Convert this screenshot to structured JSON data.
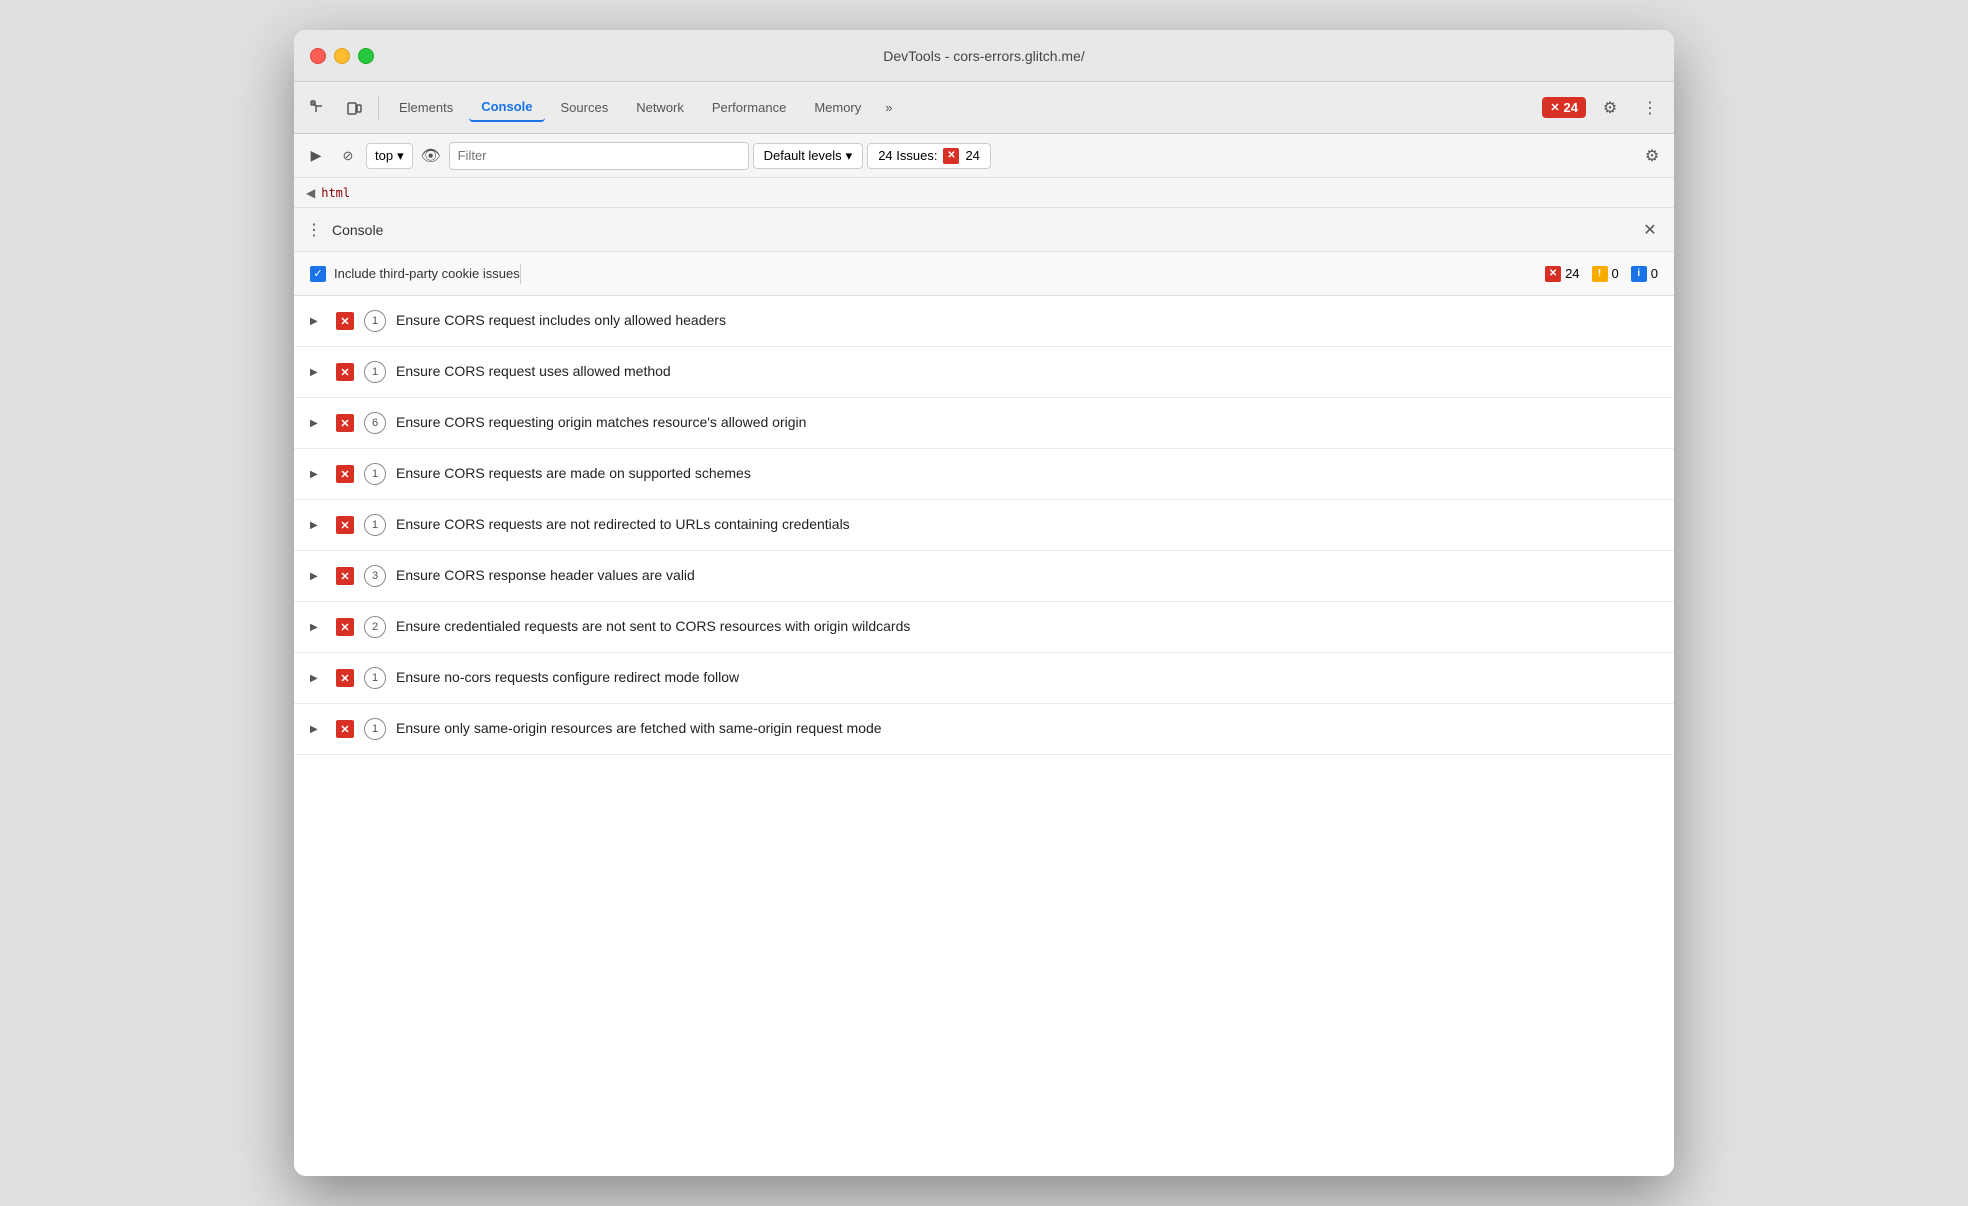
{
  "window": {
    "title": "DevTools - cors-errors.glitch.me/"
  },
  "traffic_lights": {
    "red": "red",
    "yellow": "yellow",
    "green": "green"
  },
  "tabs": [
    {
      "id": "elements",
      "label": "Elements",
      "active": false
    },
    {
      "id": "console",
      "label": "Console",
      "active": true
    },
    {
      "id": "sources",
      "label": "Sources",
      "active": false
    },
    {
      "id": "network",
      "label": "Network",
      "active": false
    },
    {
      "id": "performance",
      "label": "Performance",
      "active": false
    },
    {
      "id": "memory",
      "label": "Memory",
      "active": false
    }
  ],
  "toolbar": {
    "more_label": "»",
    "error_count": "24",
    "gear_icon": "⚙",
    "more_icon": "⋮"
  },
  "console_toolbar": {
    "play_icon": "▶",
    "ban_icon": "🚫",
    "top_label": "top",
    "dropdown_icon": "▾",
    "eye_icon": "👁",
    "filter_placeholder": "Filter",
    "levels_label": "Default levels",
    "levels_dropdown": "▾",
    "issues_label": "24 Issues:",
    "issues_count": "24",
    "gear_icon": "⚙"
  },
  "breadcrumb": {
    "arrow": "◀",
    "html_tag": "html"
  },
  "drawer": {
    "menu_icon": "⋮",
    "title": "Console",
    "close_icon": "✕"
  },
  "issues_header": {
    "checkbox_label": "Include third-party cookie issues",
    "error_count": "24",
    "warning_count": "0",
    "info_count": "0"
  },
  "issues": [
    {
      "count": "1",
      "text": "Ensure CORS request includes only allowed headers"
    },
    {
      "count": "1",
      "text": "Ensure CORS request uses allowed method"
    },
    {
      "count": "6",
      "text": "Ensure CORS requesting origin matches resource's allowed origin"
    },
    {
      "count": "1",
      "text": "Ensure CORS requests are made on supported schemes"
    },
    {
      "count": "1",
      "text": "Ensure CORS requests are not redirected to URLs containing credentials"
    },
    {
      "count": "3",
      "text": "Ensure CORS response header values are valid"
    },
    {
      "count": "2",
      "text": "Ensure credentialed requests are not sent to CORS resources with origin wildcards"
    },
    {
      "count": "1",
      "text": "Ensure no-cors requests configure redirect mode follow"
    },
    {
      "count": "1",
      "text": "Ensure only same-origin resources are fetched with same-origin request mode"
    }
  ]
}
